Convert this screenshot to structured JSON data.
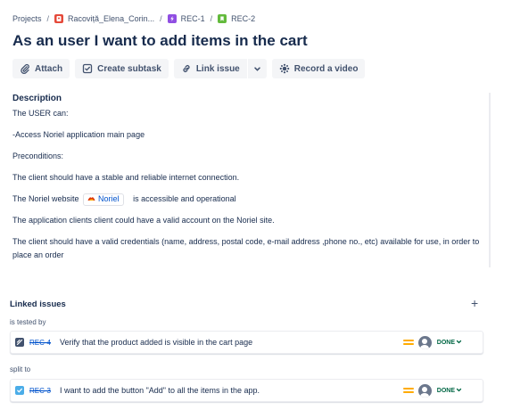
{
  "breadcrumb": {
    "items": [
      {
        "label": "Projects"
      },
      {
        "label": "Racoviță_Elena_Corin...",
        "icon": "project-avatar-icon",
        "color": "#e5493a"
      },
      {
        "label": "REC-1",
        "icon": "epic-icon",
        "color": "#904ee2"
      },
      {
        "label": "REC-2",
        "icon": "story-icon",
        "color": "#63ba3c"
      }
    ],
    "separator": "/"
  },
  "title": "As an user I want to add items in the cart",
  "toolbar": {
    "attach": "Attach",
    "create_subtask": "Create subtask",
    "link_issue": "Link issue",
    "record_video": "Record a video"
  },
  "description": {
    "heading": "Description",
    "p1": "The USER can:",
    "p2": "-Access Noriel application main page",
    "p3": "Preconditions:",
    "p4": "The client should have a stable and reliable internet connection.",
    "p5_before": "The Noriel website",
    "p5_chip": "Noriel",
    "p5_after": "is accessible and operational",
    "p6": "The application clients client could have a valid account on the Noriel site.",
    "p7": "The client should have a valid credentials (name, address, postal code, e-mail address ,phone no., etc) available for use, in order to place an order"
  },
  "linked_issues": {
    "heading": "Linked issues",
    "add_symbol": "+",
    "groups": [
      {
        "label": "is tested by",
        "issue": {
          "key": "REC-4",
          "summary": "Verify that the product added is visible in the cart page",
          "type_icon": "test-icon",
          "type_color": "#42526e",
          "status": "DONE"
        }
      },
      {
        "label": "split to",
        "issue": {
          "key": "REC-3",
          "summary": "I want to add the button \"Add\" to all the items in the app.",
          "type_icon": "task-icon",
          "type_color": "#4bade8",
          "status": "DONE"
        }
      }
    ]
  },
  "colors": {
    "link": "#0052cc",
    "priority_medium": "#ffab00",
    "status_done": "#006644",
    "button_bg": "#f4f5f7"
  }
}
